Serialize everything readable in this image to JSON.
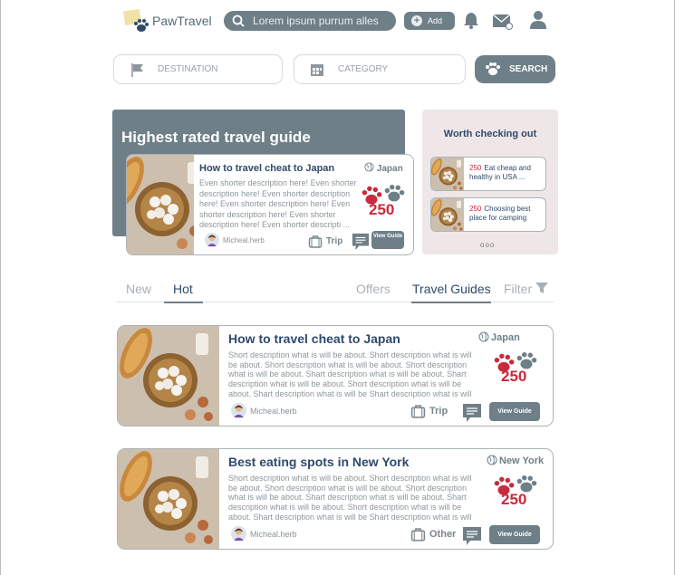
{
  "header": {
    "brand": "PawTravel",
    "search_placeholder": "Lorem ipsum purrum alles",
    "add_label": "Add",
    "icons": [
      "bell-icon",
      "mail-icon",
      "user-icon"
    ]
  },
  "filters": {
    "destination_label": "DESTINATION",
    "category_label": "CATEGORY",
    "search_label": "SEARCH"
  },
  "hero": {
    "title": "Highest rated travel guide",
    "card": {
      "title": "How to travel cheat to Japan",
      "description": "Even shorter description here! Even shorter description here! Even shorter description here! Even shorter description here! Even shorter description here! Even shorter description here! Even shorter descripti ...",
      "location": "Japan",
      "paw_count": "250",
      "author": "Micheal.herb",
      "category": "Trip",
      "view_label": "View Guide"
    }
  },
  "side": {
    "title": "Worth checking out",
    "items": [
      {
        "count": "250",
        "text": "Eat cheap and healthy in USA ..."
      },
      {
        "count": "250",
        "text": "Choosing best place for camping"
      }
    ],
    "pager": "ooo"
  },
  "tabs": {
    "new": "New",
    "hot": "Hot",
    "offers": "Offers",
    "travel_guides": "Travel Guides",
    "filter": "Filter"
  },
  "guides": [
    {
      "title": "How to travel cheat to Japan",
      "description": "Short description what is will be about. Short description what is will be about. Short description what is will be about. Short description what is will be about. Shart description what is will be about. Shart description what is will be about. Short description what is will be about. Shart description what is will be Shart description what is will be .....",
      "location": "Japan",
      "paw_count": "250",
      "author": "Micheal.herb",
      "category": "Trip",
      "view_label": "View Guide"
    },
    {
      "title": "Best eating spots in New York",
      "description": "Short description what is will be about. Short description what is will be about. Short description what is will be about. Short description what is will be about. Shart description what is will be about. Shart description what is will be about. Short description what is will be about. Shart description what is will be Shart description what is will be .....",
      "location": "New York",
      "paw_count": "250",
      "author": "Micheal.herb",
      "category": "Other",
      "view_label": "View Guide"
    }
  ],
  "colors": {
    "accent": "#6e7f88",
    "title": "#2f4a6b",
    "paw_red": "#c92a3d",
    "side_bg": "#efe6e8"
  }
}
